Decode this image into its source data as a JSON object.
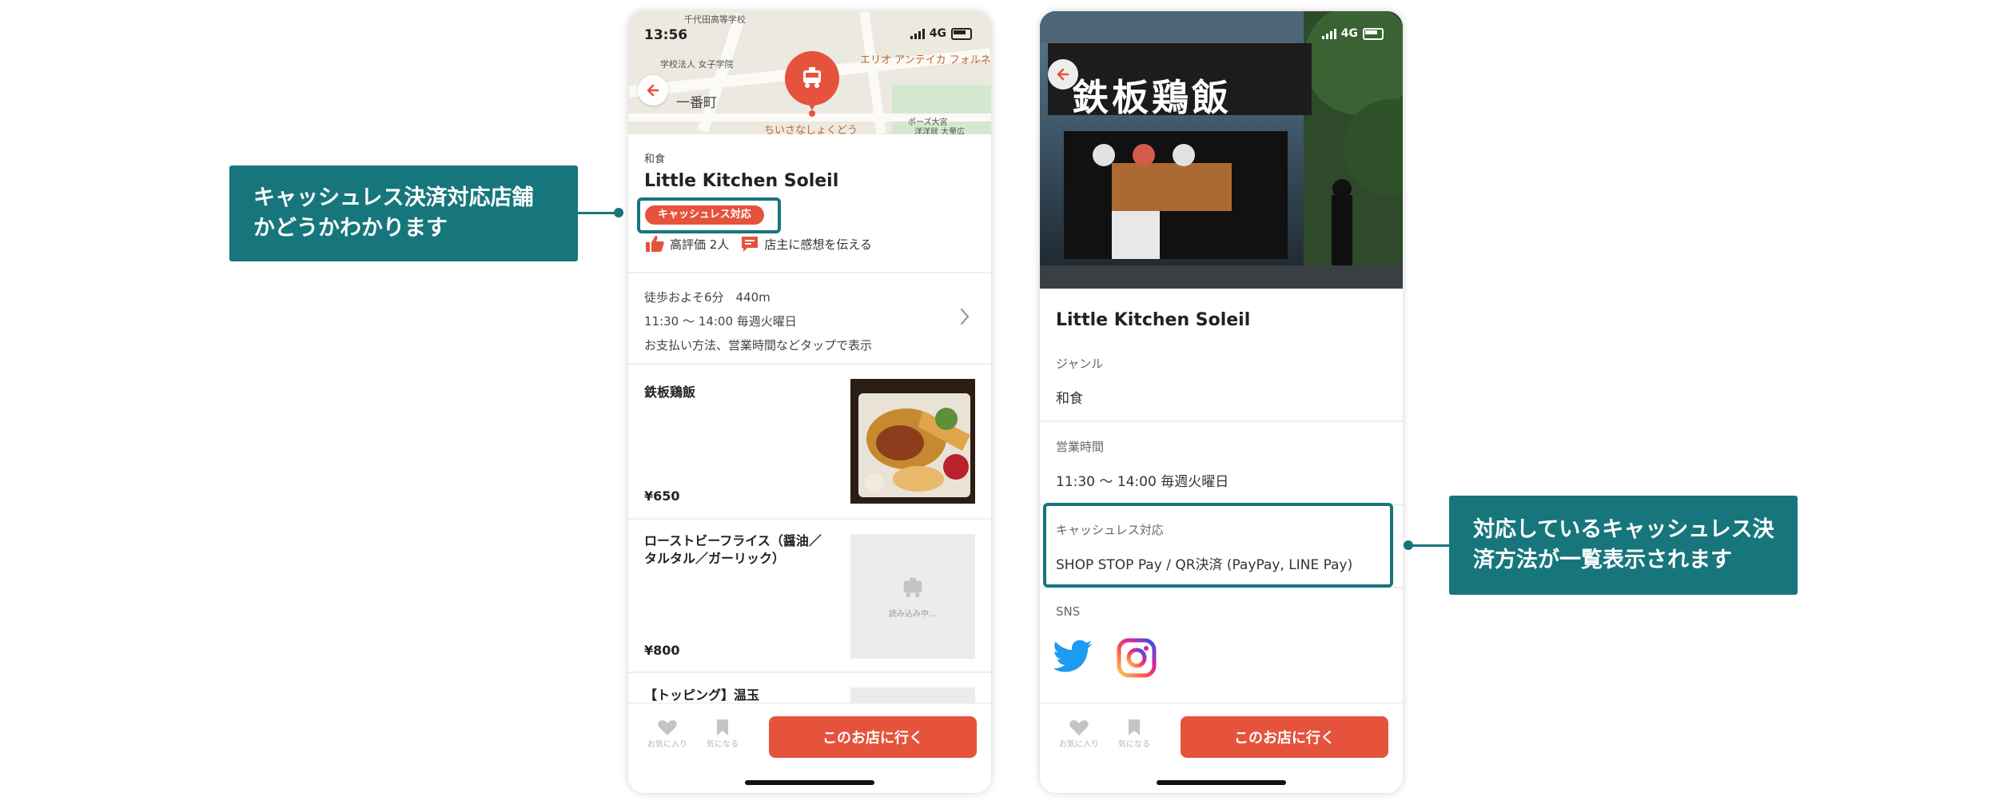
{
  "callouts": {
    "left": [
      "キャッシュレス決済対応店舗",
      "かどうかわかります"
    ],
    "right": [
      "対応しているキャッシュレス決",
      "済方法が一覧表示されます"
    ]
  },
  "phone1": {
    "status_time": "13:56",
    "network": "4G",
    "map_labels": [
      "千代田高等学校",
      "学校法人 女子学院",
      "一番町",
      "エリオ アンテイカ フォルネリ",
      "ちいさなしょくどう",
      "ポーズ大宮",
      "洋洋就 大量広"
    ],
    "genre": "和食",
    "shop_name": "Little Kitchen Soleil",
    "badge": "キャッシュレス対応",
    "rating_text": "高評価 2人",
    "feedback_text": "店主に感想を伝える",
    "info": {
      "walk": "徒歩およそ6分　440m",
      "hours": "11:30 〜 14:00 毎週火曜日",
      "hint": "お支払い方法、営業時間などタップで表示"
    },
    "menu": [
      {
        "name": [
          "鉄板鶏飯"
        ],
        "price": "¥650",
        "image": "photo"
      },
      {
        "name": [
          "ローストビーフライス（醤油／",
          "タルタル／ガーリック）"
        ],
        "price": "¥800",
        "image": "placeholder",
        "placeholder_text": "読み込み中…"
      },
      {
        "name": [
          "【トッピング】温玉"
        ],
        "price": "",
        "image": "placeholder"
      }
    ],
    "tab_favorite": "お気に入り",
    "tab_interest": "気になる",
    "cta": "このお店に行く"
  },
  "phone2": {
    "network": "4G",
    "shop_name": "Little Kitchen Soleil",
    "sign_text": "鉄板鶏飯",
    "sections": {
      "genre_label": "ジャンル",
      "genre_value": "和食",
      "hours_label": "営業時間",
      "hours_value": "11:30 〜 14:00 毎週火曜日",
      "cashless_label": "キャッシュレス対応",
      "cashless_value": "SHOP STOP Pay / QR決済 (PayPay, LINE Pay)",
      "sns_label": "SNS"
    },
    "sns_icons": [
      "twitter-icon",
      "instagram-icon"
    ],
    "tab_favorite": "お気に入り",
    "tab_interest": "気になる",
    "cta": "このお店に行く"
  },
  "colors": {
    "accent": "#e5533d",
    "callout_teal": "#17767c"
  }
}
